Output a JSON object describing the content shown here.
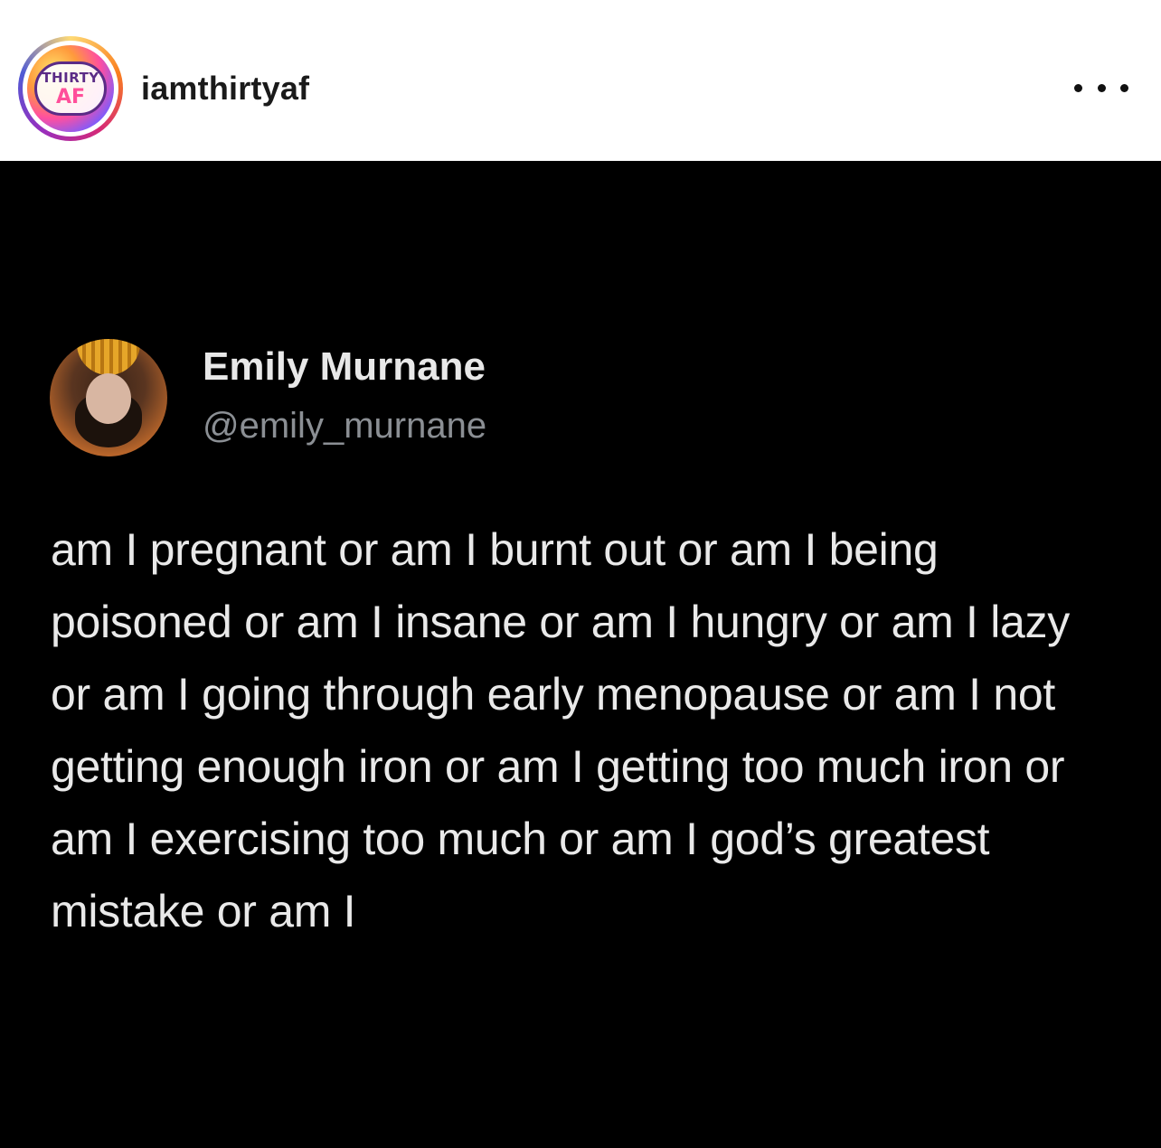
{
  "post_header": {
    "avatar_text_line1": "THIRTY",
    "avatar_text_line2": "AF",
    "username": "iamthirtyaf",
    "more_icon": "more-horizontal-icon"
  },
  "tweet": {
    "display_name": "Emily Murnane",
    "handle": "@emily_murnane",
    "text": "am I pregnant or am I burnt out or am I being poisoned or am I insane or am I hungry or am I lazy or am I going through early menopause or am I not getting enough iron or am I getting too much iron or am I exercising too much or am I god’s greatest mistake or am I"
  },
  "colors": {
    "header_bg": "#ffffff",
    "post_bg": "#000000",
    "tweet_text": "#e9e9e9",
    "handle_text": "#8b8f94"
  }
}
